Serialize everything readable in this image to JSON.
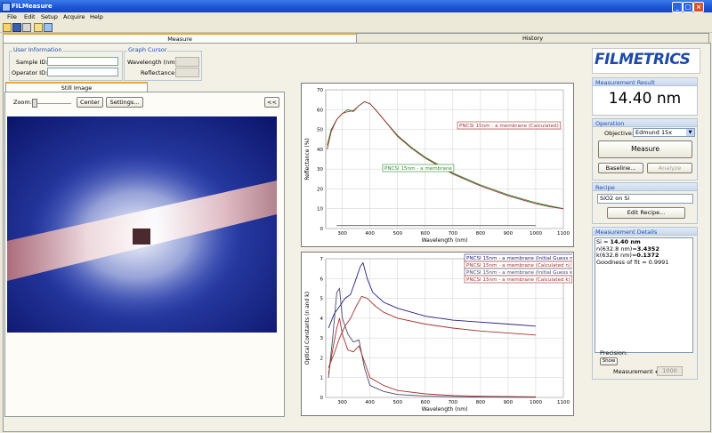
{
  "window": {
    "title": "FILMeasure"
  },
  "menu": [
    "File",
    "Edit",
    "Setup",
    "Acquire",
    "Help"
  ],
  "tabs": {
    "measure": "Measure",
    "history": "History"
  },
  "user_info": {
    "legend": "User Information",
    "sample_label": "Sample ID:",
    "sample_value": "",
    "operator_label": "Operator ID:",
    "operator_value": ""
  },
  "graph_cursor": {
    "legend": "Graph Cursor",
    "wavelength_label": "Wavelength (nm):",
    "reflectance_label": "Reflectance:"
  },
  "still_image": {
    "tab": "Still Image",
    "zoom_label": "Zoom:",
    "center_btn": "Center",
    "settings_btn": "Settings...",
    "collapse_btn": "<<"
  },
  "logo": "FILMETRICS",
  "measurement_result": {
    "label": "Measurement Result",
    "value": "14.40 nm"
  },
  "operation": {
    "label": "Operation",
    "objective_label": "Objective:",
    "objective_value": "Edmund 15x",
    "measure_btn": "Measure",
    "baseline_btn": "Baseline...",
    "analyze_btn": "Analyze"
  },
  "recipe": {
    "label": "Recipe",
    "value": "SiO2 on Si",
    "edit_btn": "Edit Recipe..."
  },
  "details": {
    "label": "Measurement Details",
    "line1_prefix": "Si = ",
    "line1_value": "14.40 nm",
    "line2_prefix": "n(632.8 nm)=",
    "line2_value": "3.4352",
    "line3_prefix": "k(632.8 nm)=",
    "line3_value": "0.1372",
    "line4": "Goodness of fit = 0.9991",
    "precision_label": "Precision:",
    "show_btn": "Show",
    "measurement_num_label": "Measurement #",
    "measurement_num_value": "1000"
  },
  "colors": {
    "measured": "#2e8b2e",
    "calculated": "#a0352f",
    "n_guess": "#25207a",
    "n_calc": "#a0352f",
    "k_guess": "#4a4a6a",
    "k_calc": "#a0352f"
  },
  "chart_data": [
    {
      "type": "line",
      "xlabel": "Wavelength (nm)",
      "ylabel": "Reflectance (%)",
      "xlim": [
        240,
        1100
      ],
      "ylim": [
        0,
        70
      ],
      "xticks": [
        300,
        400,
        500,
        600,
        700,
        800,
        900,
        1000,
        1100
      ],
      "yticks": [
        0,
        10,
        20,
        30,
        40,
        50,
        60,
        70
      ],
      "grid": true,
      "series": [
        {
          "name": "PNCSI 15nm - a membrane",
          "x": [
            245,
            260,
            280,
            300,
            320,
            340,
            360,
            380,
            400,
            420,
            450,
            500,
            550,
            600,
            650,
            700,
            750,
            800,
            850,
            900,
            950,
            1000,
            1050,
            1100
          ],
          "y": [
            42,
            50,
            55,
            58,
            60,
            59,
            62,
            64,
            63,
            60,
            55,
            47,
            41,
            36,
            32,
            28,
            25,
            22,
            19.5,
            17,
            15,
            13,
            11.5,
            10
          ]
        },
        {
          "name": "PNCSI 15nm - a membrane (Calculated)",
          "x": [
            245,
            260,
            280,
            300,
            320,
            340,
            360,
            380,
            400,
            420,
            450,
            500,
            550,
            600,
            650,
            700,
            750,
            800,
            850,
            900,
            950,
            1000,
            1050,
            1100
          ],
          "y": [
            40,
            49,
            55,
            58,
            59,
            59.5,
            62,
            64,
            63,
            60,
            55,
            46.5,
            40.5,
            35.5,
            31.5,
            27.5,
            24.5,
            21.5,
            19,
            16.5,
            14.5,
            12.5,
            11,
            10
          ]
        },
        {
          "name": "",
          "x": [
            280,
            1000
          ],
          "y": [
            1.5,
            1.5
          ]
        }
      ]
    },
    {
      "type": "line",
      "xlabel": "Wavelength (nm)",
      "ylabel": "Optical Constants (n and k)",
      "xlim": [
        240,
        1100
      ],
      "ylim": [
        0,
        7
      ],
      "xticks": [
        300,
        400,
        500,
        600,
        700,
        800,
        900,
        1000,
        1100
      ],
      "yticks": [
        0,
        1,
        2,
        3,
        4,
        5,
        6,
        7
      ],
      "grid": true,
      "series": [
        {
          "name": "PNCSI 15nm - a membrane (Initial Guess n)",
          "x": [
            250,
            270,
            290,
            310,
            330,
            350,
            365,
            375,
            390,
            410,
            450,
            500,
            600,
            700,
            800,
            900,
            1000
          ],
          "y": [
            3.5,
            4.2,
            4.6,
            5.0,
            5.2,
            6.0,
            6.6,
            6.8,
            6.0,
            5.3,
            4.8,
            4.5,
            4.1,
            3.9,
            3.8,
            3.7,
            3.6
          ]
        },
        {
          "name": "PNCSI 15nm - a membrane (Calculated n)",
          "x": [
            250,
            270,
            290,
            310,
            330,
            350,
            370,
            390,
            420,
            450,
            500,
            600,
            700,
            800,
            900,
            1000
          ],
          "y": [
            1.5,
            2.2,
            3.0,
            3.6,
            4.0,
            4.6,
            5.1,
            5.0,
            4.6,
            4.3,
            4.0,
            3.7,
            3.5,
            3.35,
            3.25,
            3.15
          ]
        },
        {
          "name": "PNCSI 15nm - a membrane (Initial Guess k)",
          "x": [
            250,
            265,
            280,
            290,
            300,
            320,
            340,
            360,
            380,
            400,
            450,
            500,
            600,
            700,
            800,
            1000
          ],
          "y": [
            1.0,
            3.0,
            5.3,
            5.5,
            4.0,
            3.2,
            2.8,
            2.9,
            1.5,
            0.6,
            0.3,
            0.15,
            0.07,
            0.04,
            0.02,
            0.01
          ]
        },
        {
          "name": "PNCSI 15nm - a membrane (Calculated k)",
          "x": [
            250,
            265,
            280,
            290,
            300,
            320,
            340,
            360,
            380,
            400,
            450,
            500,
            600,
            700,
            800,
            1000
          ],
          "y": [
            1.2,
            2.4,
            3.5,
            4.0,
            3.2,
            2.4,
            2.3,
            2.6,
            1.8,
            1.0,
            0.6,
            0.35,
            0.18,
            0.1,
            0.06,
            0.03
          ]
        }
      ]
    }
  ]
}
